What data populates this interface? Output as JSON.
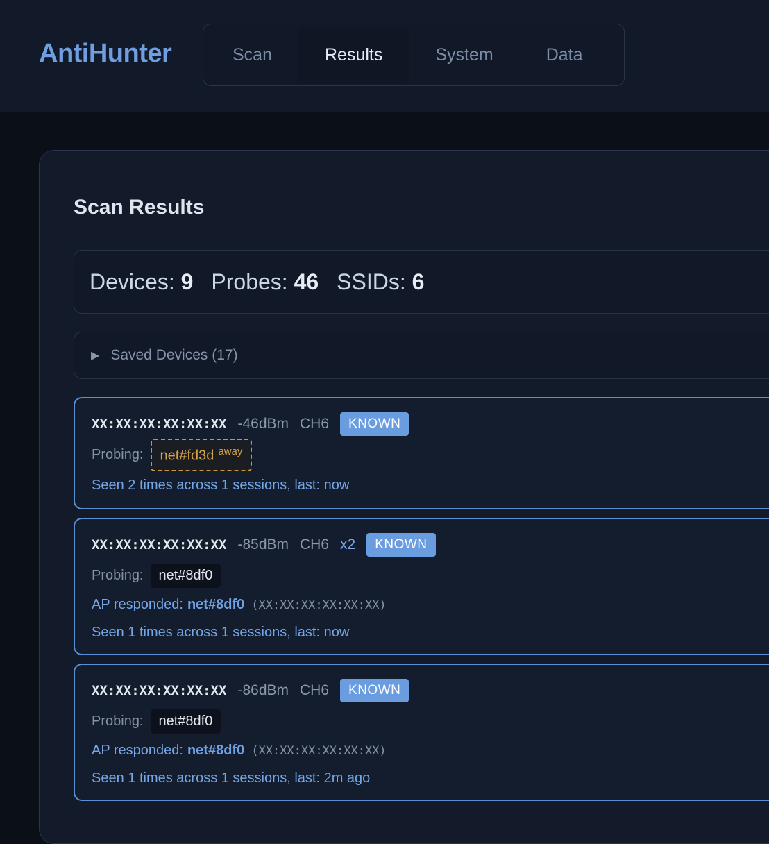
{
  "app": {
    "brand": "AntiHunter"
  },
  "nav": {
    "tabs": [
      {
        "label": "Scan"
      },
      {
        "label": "Results"
      },
      {
        "label": "System"
      },
      {
        "label": "Data"
      }
    ],
    "active": "Results"
  },
  "panel": {
    "title": "Scan Results",
    "stats": {
      "devices_label": "Devices:",
      "devices": "9",
      "probes_label": "Probes:",
      "probes": "46",
      "ssids_label": "SSIDs:",
      "ssids": "6"
    },
    "saved": {
      "label": "Saved Devices (17)"
    }
  },
  "devices": [
    {
      "mac": "XX:XX:XX:XX:XX:XX",
      "rssi": "-46dBm",
      "channel": "CH6",
      "badge": "KNOWN",
      "probing_label": "Probing:",
      "ssid": "net#fd3d",
      "ssid_tag": "away",
      "seen": "Seen 2 times across 1 sessions, last: now"
    },
    {
      "mac": "XX:XX:XX:XX:XX:XX",
      "rssi": "-85dBm",
      "channel": "CH6",
      "count": "x2",
      "badge": "KNOWN",
      "probing_label": "Probing:",
      "ssid": "net#8df0",
      "ap_label": "AP responded:",
      "ap_ssid": "net#8df0",
      "ap_mac": "(XX:XX:XX:XX:XX:XX)",
      "seen": "Seen 1 times across 1 sessions, last: now"
    },
    {
      "mac": "XX:XX:XX:XX:XX:XX",
      "rssi": "-86dBm",
      "channel": "CH6",
      "badge": "KNOWN",
      "probing_label": "Probing:",
      "ssid": "net#8df0",
      "ap_label": "AP responded:",
      "ap_ssid": "net#8df0",
      "ap_mac": "(XX:XX:XX:XX:XX:XX)",
      "seen": "Seen 1 times across 1 sessions, last: 2m ago"
    }
  ],
  "colors": {
    "accent": "#6a9de0",
    "away": "#d8a24a",
    "card_border": "#5b8fd3"
  }
}
